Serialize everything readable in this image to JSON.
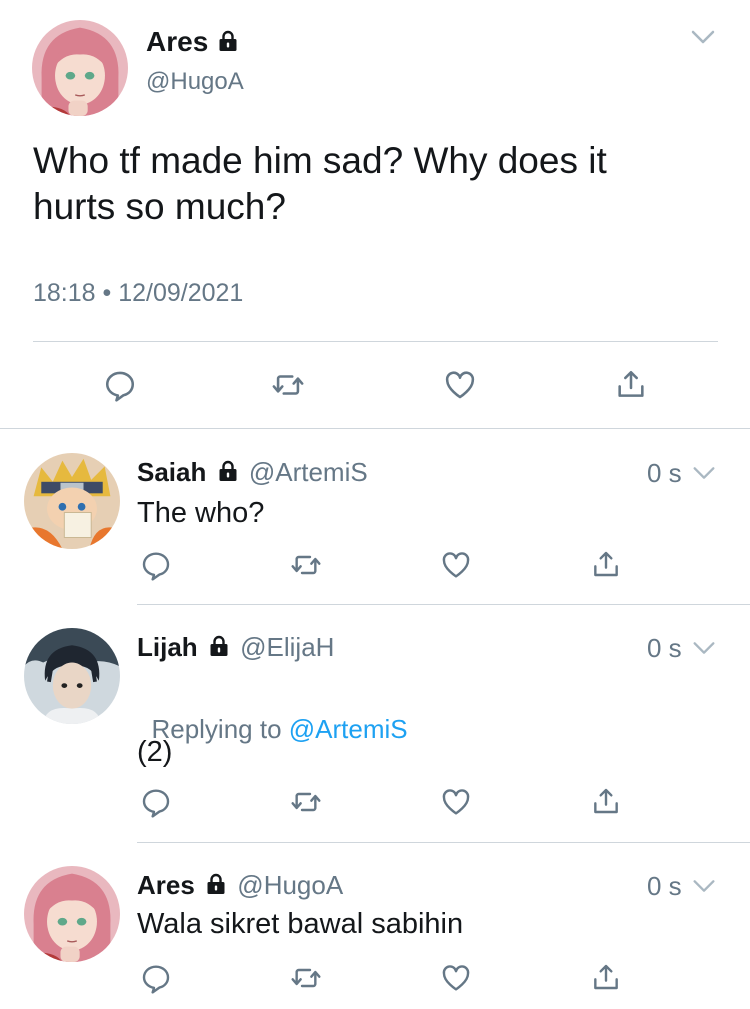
{
  "main_tweet": {
    "display_name": "Ares",
    "handle": "@HugoA",
    "text_line1": "Who tf made him sad? Why does it",
    "text_line2": "hurts so much?",
    "timestamp": "18:18 • 12/09/2021"
  },
  "replies": [
    {
      "display_name": "Saiah",
      "handle": "@ArtemiS",
      "time": "0 s",
      "text": "The who?"
    },
    {
      "display_name": "Lijah",
      "handle": "@ElijaH",
      "time": "0 s",
      "replying_prefix": "Replying to ",
      "replying_to": "@ArtemiS",
      "text": "(2)"
    },
    {
      "display_name": "Ares",
      "handle": "@HugoA",
      "time": "0 s",
      "text": "Wala sikret bawal sabihin"
    }
  ],
  "colors": {
    "icon_gray": "#657786",
    "link_blue": "#1da1f2",
    "divider": "#cfd6dc"
  },
  "icons": [
    "reply-icon",
    "retweet-icon",
    "like-icon",
    "share-icon",
    "lock-icon",
    "chevron-down-icon"
  ]
}
